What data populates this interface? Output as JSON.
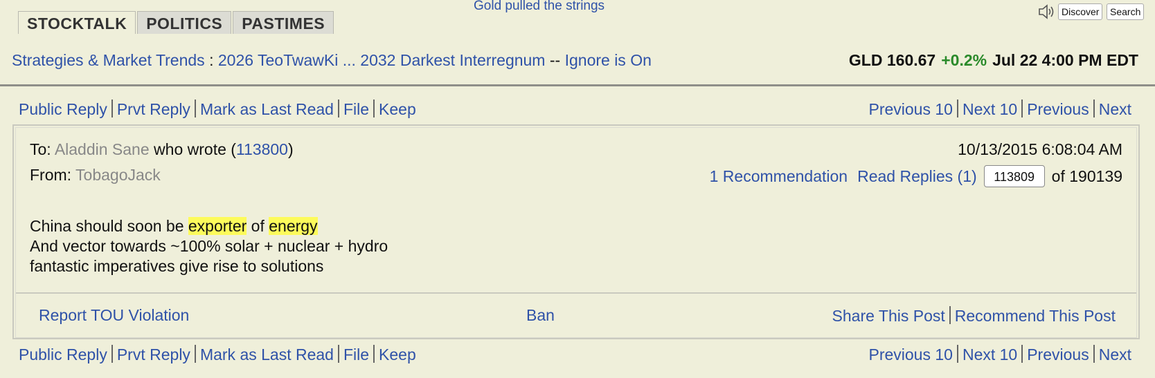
{
  "tabs": [
    "STOCKTALK",
    "POLITICS",
    "PASTIMES"
  ],
  "headline": "Gold pulled the strings",
  "top_buttons": {
    "discover": "Discover",
    "search": "Search"
  },
  "breadcrumb": {
    "board": "Strategies & Market Trends",
    "sep": ":",
    "thread": "2026 TeoTwawKi ... 2032 Darkest Interregnum",
    "dash": "--",
    "ignore": "Ignore is On"
  },
  "quote": {
    "symbol": "GLD 160.67",
    "change": "+0.2%",
    "time": "Jul 22 4:00 PM EDT",
    "change_color": "#2a8a2a"
  },
  "actions": {
    "public_reply": "Public Reply",
    "prvt_reply": "Prvt Reply",
    "mark_last_read": "Mark as Last Read",
    "file": "File",
    "keep": "Keep",
    "prev10": "Previous 10",
    "next10": "Next 10",
    "previous": "Previous",
    "next": "Next"
  },
  "post": {
    "to_label": "To:",
    "to_name": "Aladdin Sane",
    "who_wrote": "who wrote (",
    "ref_msg": "113800",
    "close_paren": ")",
    "from_label": "From:",
    "from_name": "TobagoJack",
    "datetime": "10/13/2015 6:08:04 AM",
    "recommendations": "1 Recommendation",
    "read_replies": "Read Replies (1)",
    "msg_number": "113809",
    "of_total": "of 190139",
    "line1_a": "China should soon be ",
    "line1_hl1": "exporter",
    "line1_b": " of ",
    "line1_hl2": "energy",
    "line2": "And vector towards ~100% solar + nuclear + hydro",
    "line3": "fantastic imperatives give rise to solutions"
  },
  "post_footer": {
    "report": "Report TOU Violation",
    "ban": "Ban",
    "share": "Share This Post",
    "recommend": "Recommend This Post"
  }
}
